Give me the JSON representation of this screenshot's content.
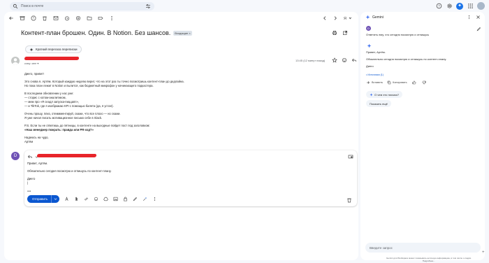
{
  "search": {
    "placeholder": "Поиск в почте"
  },
  "header": {
    "icons": [
      "tune-icon",
      "help-icon",
      "gear-icon",
      "gemini-icon",
      "apps-icon",
      "avatar"
    ]
  },
  "toolbar": {
    "left_icons": [
      "back-arrow-icon",
      "archive-icon",
      "report-spam-icon",
      "delete-icon",
      "mark-unread-icon",
      "snooze-icon",
      "add-task-icon",
      "move-to-icon",
      "label-icon",
      "more-vert-icon"
    ],
    "right_icons": [
      "newer-icon",
      "older-icon",
      "input-tools-icon"
    ]
  },
  "message": {
    "subject": "Контент-план брошен. Один. В Notion. Без шансов.",
    "label": "Входящие ×",
    "summary_chip": "Краткий пересказ переписки",
    "to_line": "кому: мне ▾",
    "time": "13:45 (12 минут назад)",
    "body": [
      "Диего, привет!",
      "Это снова я. Артём. Который каждую неделю верит, что на этот раз ты точно посмотришь контент-план до дедлайна.\nНо пока план лежит в Notion и пылится, как бюджетный микрофон у начинающего подкастера.",
      "В последнем обновлении у нас уже:\n— сторис с котом-аналитиком,\n— мем про «Я сеадл запуска-пиццапп»,\n— и TikTok, где я изображаю KPI с помощью балета (да, я устал).",
      "Очень прошу, плиз, отеммментируй, скажи, что все плохо — но скажи.\nЯ уже начал писать мотивационное письмо себе в Slack.",
      "P.S. Если ты не ответишь до пятницы, в контенте на выходные пойдет пост под заголовком:",
      "Надеюсь на чудо,\nАртём"
    ],
    "body_bold": "«Наш менеджер пожрать: правда или PR-ход?»"
  },
  "reply": {
    "avatar_letter": "D",
    "lines": [
      "Привет, Артём.",
      "Обязательно сегодня посмотрю и отпишусь по контент-плану.",
      "Диего\n|"
    ],
    "ellipsis": "•••",
    "send_label": "Отправить",
    "format_icons": [
      "format-text-icon",
      "attach-icon",
      "link-icon",
      "emoji-icon",
      "drive-icon",
      "photo-icon",
      "lock-icon",
      "signature-icon",
      "more-options-icon"
    ]
  },
  "gemini": {
    "title": "Gemini",
    "user_avatar": "D",
    "user_prompt": "Ответить ему, что сегодня посмотрю и отпишусь",
    "reply_lines": [
      "Привет, Артём.",
      "Обязательно сегодня посмотрю и отпишусь по контент-плану.",
      "Диего"
    ],
    "sources": "• Источники (1)",
    "actions": {
      "insert": "Вставить",
      "copy": "Копировать"
    },
    "suggestions": [
      "О чем это письмо?",
      "Показать ещё"
    ],
    "input_placeholder": "Введите запрос",
    "disclaimer": "Gemini для Workspace может показывать неточную информацию, в том числе о людях. Подробнее…"
  },
  "colors": {
    "accent": "#0b57d0",
    "redaction": "#e8242a",
    "avatar_purple": "#6f52b5"
  }
}
